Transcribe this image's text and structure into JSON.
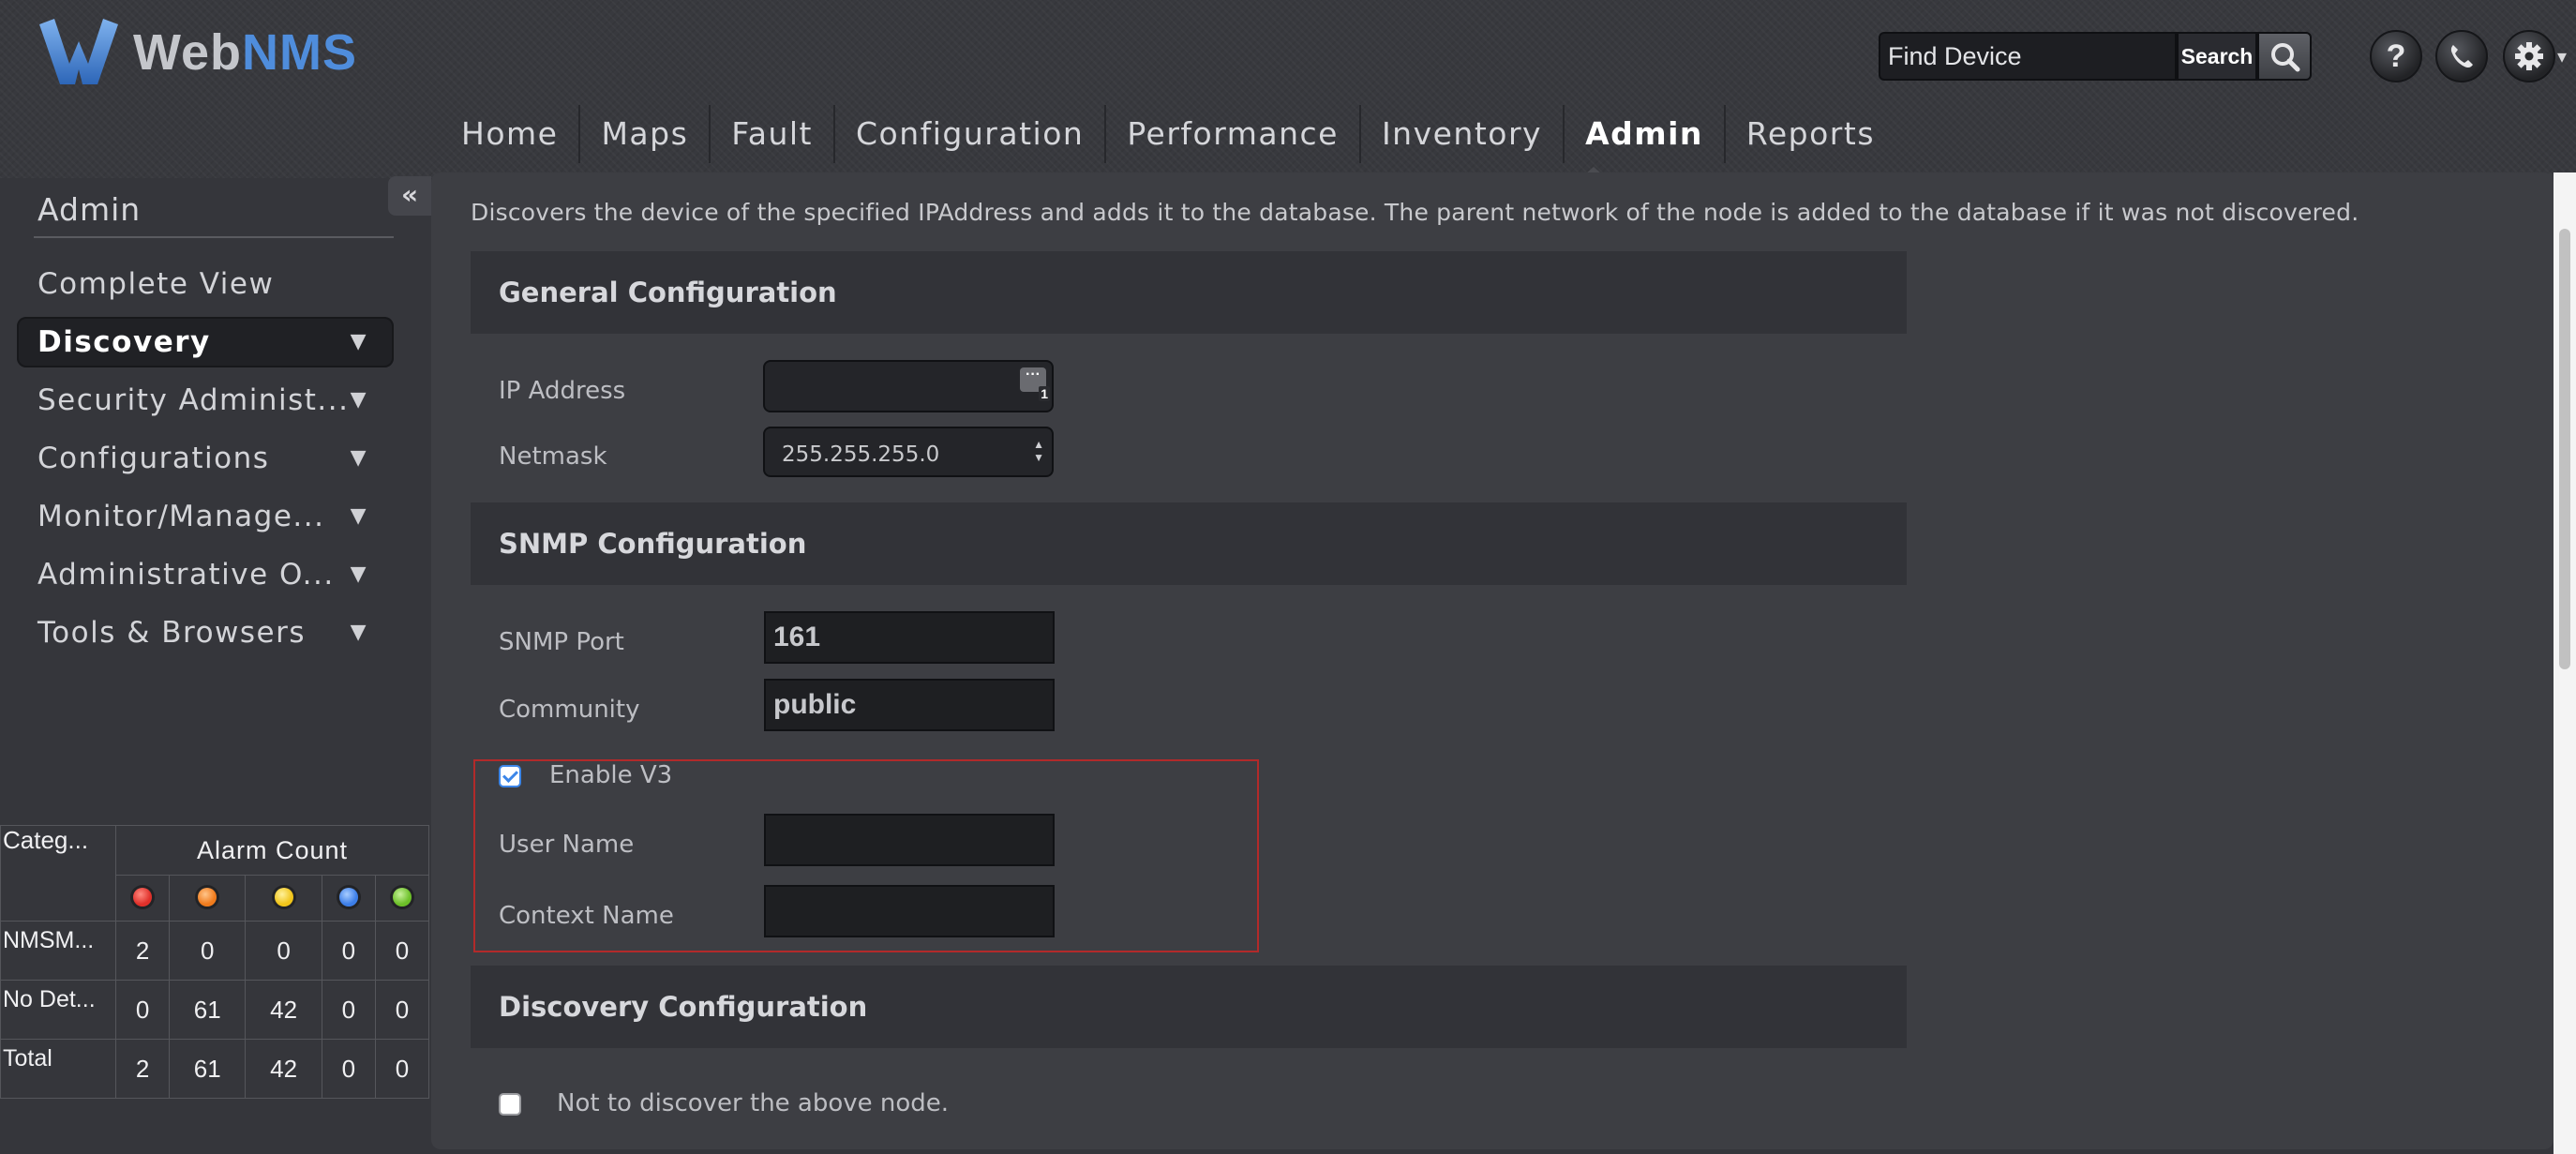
{
  "brand": {
    "logo_web": "Web",
    "logo_nms": "NMS"
  },
  "search": {
    "placeholder": "Find Device",
    "button_label": "Search"
  },
  "header_icons": {
    "help": "?",
    "phone": "phone-icon",
    "settings": "gear-icon"
  },
  "nav": {
    "items": [
      "Home",
      "Maps",
      "Fault",
      "Configuration",
      "Performance",
      "Inventory",
      "Admin",
      "Reports"
    ],
    "active": "Admin"
  },
  "sidebar": {
    "collapse_label": "«",
    "title": "Admin",
    "items": [
      {
        "label": "Complete View"
      },
      {
        "label": "Discovery"
      },
      {
        "label": "Security Administ..."
      },
      {
        "label": "Configurations"
      },
      {
        "label": "Monitor/Manage..."
      },
      {
        "label": "Administrative O..."
      },
      {
        "label": "Tools & Browsers"
      }
    ],
    "active": "Discovery"
  },
  "alarm_table": {
    "category_header": "Categ...",
    "count_header": "Alarm Count",
    "severity_colors": [
      "#e0302a",
      "#f07b1c",
      "#f0c419",
      "#3c7ee8",
      "#6cc028"
    ],
    "rows": [
      {
        "label": "NMSM...",
        "values": [
          "2",
          "0",
          "0",
          "0",
          "0"
        ]
      },
      {
        "label": "No Det...",
        "values": [
          "0",
          "61",
          "42",
          "0",
          "0"
        ]
      },
      {
        "label": "Total",
        "values": [
          "2",
          "61",
          "42",
          "0",
          "0"
        ]
      }
    ]
  },
  "main": {
    "description": "Discovers the device of the specified IPAddress and adds it to the database. The parent network of the node is added to the database if it was not discovered.",
    "general": {
      "title": "General Configuration",
      "ip_label": "IP Address",
      "ip_value": "",
      "ip_icon_badge": "1",
      "netmask_label": "Netmask",
      "netmask_value": "255.255.255.0"
    },
    "snmp": {
      "title": "SNMP Configuration",
      "port_label": "SNMP Port",
      "port_value": "161",
      "community_label": "Community",
      "community_value": "public",
      "enable_v3_label": "Enable V3",
      "enable_v3_checked": true,
      "username_label": "User Name",
      "username_value": "",
      "context_label": "Context Name",
      "context_value": ""
    },
    "discovery": {
      "title": "Discovery Configuration",
      "no_discover_label": "Not to discover the above node.",
      "no_discover_checked": false
    }
  }
}
